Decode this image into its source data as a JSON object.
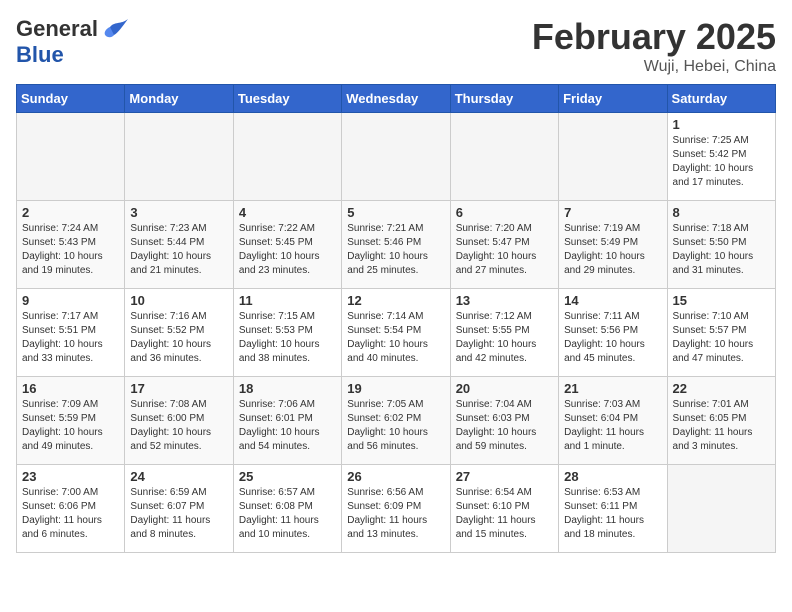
{
  "header": {
    "logo_general": "General",
    "logo_blue": "Blue",
    "month": "February 2025",
    "location": "Wuji, Hebei, China"
  },
  "weekdays": [
    "Sunday",
    "Monday",
    "Tuesday",
    "Wednesday",
    "Thursday",
    "Friday",
    "Saturday"
  ],
  "weeks": [
    [
      {
        "day": "",
        "info": ""
      },
      {
        "day": "",
        "info": ""
      },
      {
        "day": "",
        "info": ""
      },
      {
        "day": "",
        "info": ""
      },
      {
        "day": "",
        "info": ""
      },
      {
        "day": "",
        "info": ""
      },
      {
        "day": "1",
        "info": "Sunrise: 7:25 AM\nSunset: 5:42 PM\nDaylight: 10 hours\nand 17 minutes."
      }
    ],
    [
      {
        "day": "2",
        "info": "Sunrise: 7:24 AM\nSunset: 5:43 PM\nDaylight: 10 hours\nand 19 minutes."
      },
      {
        "day": "3",
        "info": "Sunrise: 7:23 AM\nSunset: 5:44 PM\nDaylight: 10 hours\nand 21 minutes."
      },
      {
        "day": "4",
        "info": "Sunrise: 7:22 AM\nSunset: 5:45 PM\nDaylight: 10 hours\nand 23 minutes."
      },
      {
        "day": "5",
        "info": "Sunrise: 7:21 AM\nSunset: 5:46 PM\nDaylight: 10 hours\nand 25 minutes."
      },
      {
        "day": "6",
        "info": "Sunrise: 7:20 AM\nSunset: 5:47 PM\nDaylight: 10 hours\nand 27 minutes."
      },
      {
        "day": "7",
        "info": "Sunrise: 7:19 AM\nSunset: 5:49 PM\nDaylight: 10 hours\nand 29 minutes."
      },
      {
        "day": "8",
        "info": "Sunrise: 7:18 AM\nSunset: 5:50 PM\nDaylight: 10 hours\nand 31 minutes."
      }
    ],
    [
      {
        "day": "9",
        "info": "Sunrise: 7:17 AM\nSunset: 5:51 PM\nDaylight: 10 hours\nand 33 minutes."
      },
      {
        "day": "10",
        "info": "Sunrise: 7:16 AM\nSunset: 5:52 PM\nDaylight: 10 hours\nand 36 minutes."
      },
      {
        "day": "11",
        "info": "Sunrise: 7:15 AM\nSunset: 5:53 PM\nDaylight: 10 hours\nand 38 minutes."
      },
      {
        "day": "12",
        "info": "Sunrise: 7:14 AM\nSunset: 5:54 PM\nDaylight: 10 hours\nand 40 minutes."
      },
      {
        "day": "13",
        "info": "Sunrise: 7:12 AM\nSunset: 5:55 PM\nDaylight: 10 hours\nand 42 minutes."
      },
      {
        "day": "14",
        "info": "Sunrise: 7:11 AM\nSunset: 5:56 PM\nDaylight: 10 hours\nand 45 minutes."
      },
      {
        "day": "15",
        "info": "Sunrise: 7:10 AM\nSunset: 5:57 PM\nDaylight: 10 hours\nand 47 minutes."
      }
    ],
    [
      {
        "day": "16",
        "info": "Sunrise: 7:09 AM\nSunset: 5:59 PM\nDaylight: 10 hours\nand 49 minutes."
      },
      {
        "day": "17",
        "info": "Sunrise: 7:08 AM\nSunset: 6:00 PM\nDaylight: 10 hours\nand 52 minutes."
      },
      {
        "day": "18",
        "info": "Sunrise: 7:06 AM\nSunset: 6:01 PM\nDaylight: 10 hours\nand 54 minutes."
      },
      {
        "day": "19",
        "info": "Sunrise: 7:05 AM\nSunset: 6:02 PM\nDaylight: 10 hours\nand 56 minutes."
      },
      {
        "day": "20",
        "info": "Sunrise: 7:04 AM\nSunset: 6:03 PM\nDaylight: 10 hours\nand 59 minutes."
      },
      {
        "day": "21",
        "info": "Sunrise: 7:03 AM\nSunset: 6:04 PM\nDaylight: 11 hours\nand 1 minute."
      },
      {
        "day": "22",
        "info": "Sunrise: 7:01 AM\nSunset: 6:05 PM\nDaylight: 11 hours\nand 3 minutes."
      }
    ],
    [
      {
        "day": "23",
        "info": "Sunrise: 7:00 AM\nSunset: 6:06 PM\nDaylight: 11 hours\nand 6 minutes."
      },
      {
        "day": "24",
        "info": "Sunrise: 6:59 AM\nSunset: 6:07 PM\nDaylight: 11 hours\nand 8 minutes."
      },
      {
        "day": "25",
        "info": "Sunrise: 6:57 AM\nSunset: 6:08 PM\nDaylight: 11 hours\nand 10 minutes."
      },
      {
        "day": "26",
        "info": "Sunrise: 6:56 AM\nSunset: 6:09 PM\nDaylight: 11 hours\nand 13 minutes."
      },
      {
        "day": "27",
        "info": "Sunrise: 6:54 AM\nSunset: 6:10 PM\nDaylight: 11 hours\nand 15 minutes."
      },
      {
        "day": "28",
        "info": "Sunrise: 6:53 AM\nSunset: 6:11 PM\nDaylight: 11 hours\nand 18 minutes."
      },
      {
        "day": "",
        "info": ""
      }
    ]
  ]
}
